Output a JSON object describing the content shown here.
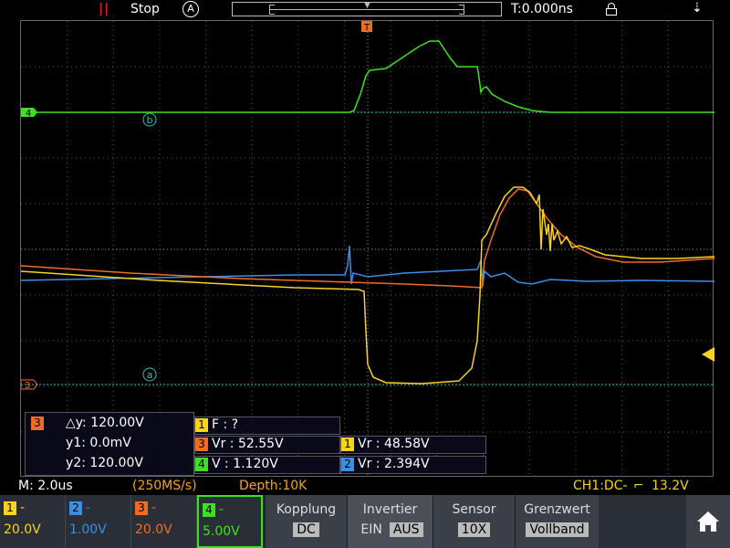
{
  "topbar": {
    "run_state": "Stop",
    "trigger_mode_icon": "A",
    "time_offset": "T:0.000ns",
    "run_icon": "pause-icon",
    "lock_icon": "lock-icon",
    "usb_icon": "usb-icon"
  },
  "markers": {
    "b_label": "b",
    "a_label": "a",
    "trigger_label": "T",
    "ch4_marker": "4",
    "ch3_marker": "3"
  },
  "cursor_box": {
    "channel": "3",
    "dy_label": "△y: 120.00V",
    "y1": "y1: 0.0mV",
    "y2": "y2: 120.00V"
  },
  "measurements": {
    "m1": {
      "channel": "1",
      "text": "F :   ?"
    },
    "m2": {
      "channel": "3",
      "text": "Vr : 52.55V"
    },
    "m3": {
      "channel": "1",
      "text": "Vr : 48.58V"
    },
    "m4": {
      "channel": "4",
      "text": "V : 1.120V"
    },
    "m5": {
      "channel": "2",
      "text": "Vr : 2.394V"
    }
  },
  "inforow": {
    "timebase": "M: 2.0us",
    "sample_rate": "(250MS/s)",
    "depth": "Depth:10K",
    "trigger": "CH1:DC-",
    "trigger_level": "13.2V"
  },
  "channels": [
    {
      "num": "1",
      "coupling": "-",
      "scale": "20.0V",
      "color": "#f7d21e"
    },
    {
      "num": "2",
      "coupling": "-",
      "scale": "1.00V",
      "color": "#3a8ee6"
    },
    {
      "num": "3",
      "coupling": "-",
      "scale": "20.0V",
      "color": "#f26b22"
    },
    {
      "num": "4",
      "coupling": "-",
      "scale": "5.00V",
      "color": "#3ee022"
    }
  ],
  "menu": {
    "kopplung": {
      "label": "Kopplung",
      "value": "DC"
    },
    "invertier": {
      "label": "Invertier",
      "on": "EIN",
      "off": "AUS"
    },
    "sensor": {
      "label": "Sensor",
      "value": "10X"
    },
    "grenzwert": {
      "label": "Grenzwert",
      "value": "Vollband"
    },
    "home_icon": "home-icon"
  },
  "colors": {
    "ch1": "#f7d21e",
    "ch2": "#3a8ee6",
    "ch3": "#f26b22",
    "ch4": "#3ee022",
    "grid": "#555555",
    "cursor": "#30c0c0"
  }
}
